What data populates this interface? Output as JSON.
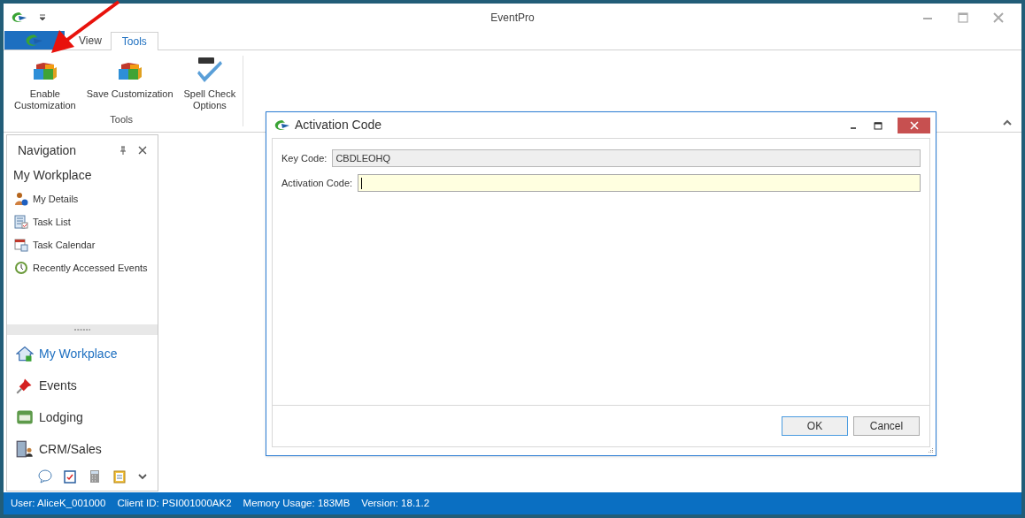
{
  "window": {
    "title": "EventPro"
  },
  "tabs": [
    {
      "label": "View",
      "selected": false
    },
    {
      "label": "Tools",
      "selected": true
    }
  ],
  "ribbon": {
    "groups": [
      {
        "label": "Tools",
        "buttons": [
          {
            "label": "Enable\nCustomization"
          },
          {
            "label": "Save Customization"
          },
          {
            "label": "Spell Check\nOptions"
          }
        ]
      }
    ]
  },
  "navigation": {
    "title": "Navigation",
    "section_title": "My Workplace",
    "items": [
      {
        "label": "My Details"
      },
      {
        "label": "Task List"
      },
      {
        "label": "Task Calendar"
      },
      {
        "label": "Recently Accessed Events"
      }
    ],
    "modules": [
      {
        "label": "My Workplace",
        "selected": true
      },
      {
        "label": "Events",
        "selected": false
      },
      {
        "label": "Lodging",
        "selected": false
      },
      {
        "label": "CRM/Sales",
        "selected": false
      }
    ]
  },
  "dialog": {
    "title": "Activation Code",
    "fields": [
      {
        "label": "Key Code:",
        "value": "CBDLEOHQ",
        "kind": "readonly"
      },
      {
        "label": "Activation Code:",
        "kind": "input",
        "focused": true
      }
    ],
    "buttons": [
      {
        "label": "OK",
        "selected": true
      },
      {
        "label": "Cancel",
        "selected": false
      }
    ]
  },
  "status_bar": [
    "User: AliceK_001000",
    "Client ID: PSI001000AK2",
    "Memory Usage: 183MB",
    "Version: 18.1.2"
  ]
}
